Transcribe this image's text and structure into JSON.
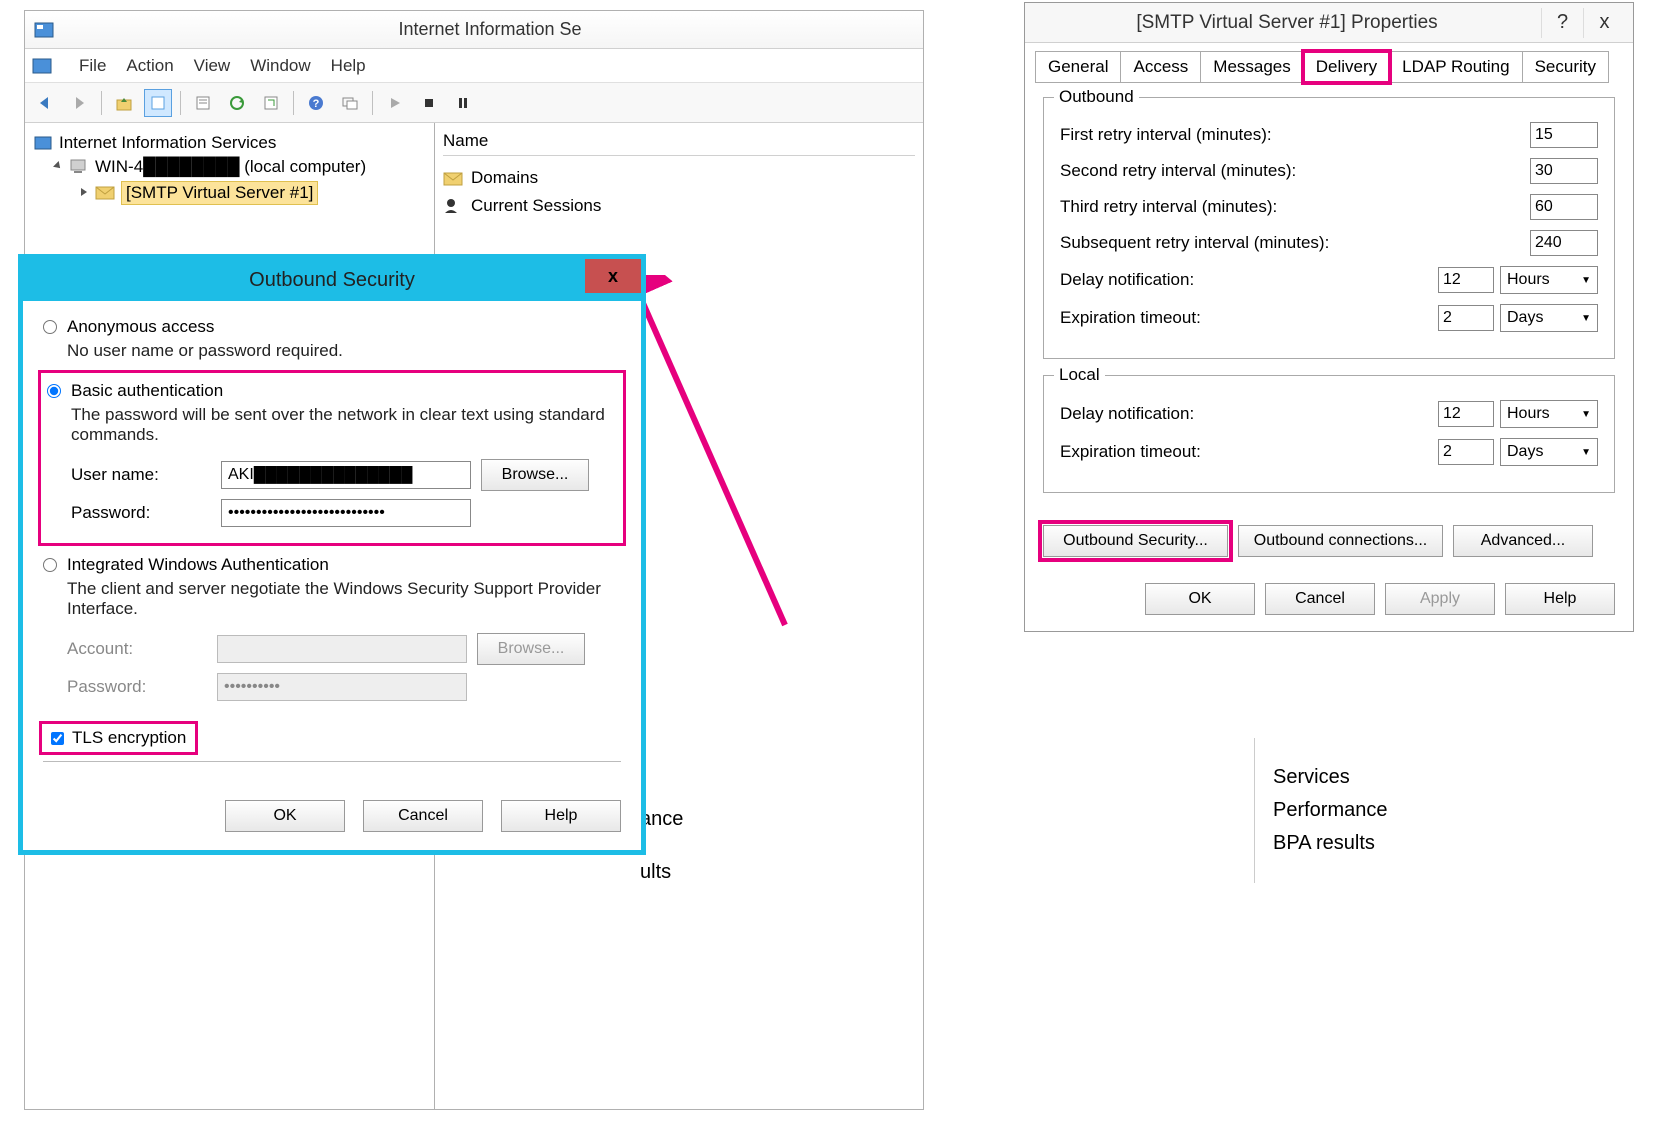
{
  "iis": {
    "title": "Internet Information Se",
    "menu": {
      "file": "File",
      "action": "Action",
      "view": "View",
      "window": "Window",
      "help": "Help"
    },
    "tree": {
      "root": "Internet Information Services",
      "computer": "WIN-4████████ (local computer)",
      "smtp": "[SMTP Virtual Server #1]"
    },
    "list": {
      "header": "Name",
      "domains": "Domains",
      "sessions": "Current Sessions"
    }
  },
  "props": {
    "title": "[SMTP Virtual Server #1] Properties",
    "help_btn": "?",
    "close_btn": "x",
    "tabs": {
      "general": "General",
      "access": "Access",
      "messages": "Messages",
      "delivery": "Delivery",
      "ldap": "LDAP Routing",
      "security": "Security"
    },
    "outbound": {
      "legend": "Outbound",
      "first_retry_label": "First retry interval (minutes):",
      "first_retry": "15",
      "second_retry_label": "Second retry interval (minutes):",
      "second_retry": "30",
      "third_retry_label": "Third retry interval (minutes):",
      "third_retry": "60",
      "subseq_retry_label": "Subsequent retry interval (minutes):",
      "subseq_retry": "240",
      "delay_label": "Delay notification:",
      "delay": "12",
      "delay_unit": "Hours",
      "expire_label": "Expiration timeout:",
      "expire": "2",
      "expire_unit": "Days"
    },
    "local": {
      "legend": "Local",
      "delay_label": "Delay notification:",
      "delay": "12",
      "delay_unit": "Hours",
      "expire_label": "Expiration timeout:",
      "expire": "2",
      "expire_unit": "Days"
    },
    "buttons": {
      "out_sec": "Outbound Security...",
      "out_conn": "Outbound connections...",
      "advanced": "Advanced..."
    },
    "dialog_buttons": {
      "ok": "OK",
      "cancel": "Cancel",
      "apply": "Apply",
      "help": "Help"
    }
  },
  "outsec": {
    "title": "Outbound Security",
    "close": "x",
    "anon": {
      "label": "Anonymous access",
      "desc": "No user name or password required."
    },
    "basic": {
      "label": "Basic authentication",
      "desc": "The password will be sent over the network in clear text using standard commands.",
      "user_label": "User name:",
      "user_value": "AKI██████████████",
      "pass_label": "Password:",
      "pass_value": "••••••••••••••••••••••••••••",
      "browse": "Browse..."
    },
    "iwa": {
      "label": "Integrated Windows Authentication",
      "desc": "The client and server negotiate the Windows Security Support Provider Interface.",
      "account_label": "Account:",
      "pass_label": "Password:",
      "pass_value": "••••••••••",
      "browse": "Browse..."
    },
    "tls_label": "TLS encryption",
    "buttons": {
      "ok": "OK",
      "cancel": "Cancel",
      "help": "Help"
    }
  },
  "side_left": {
    "line1": "ance",
    "line2": "ults"
  },
  "side_right": {
    "services": "Services",
    "performance": "Performance",
    "bpa": "BPA results"
  }
}
